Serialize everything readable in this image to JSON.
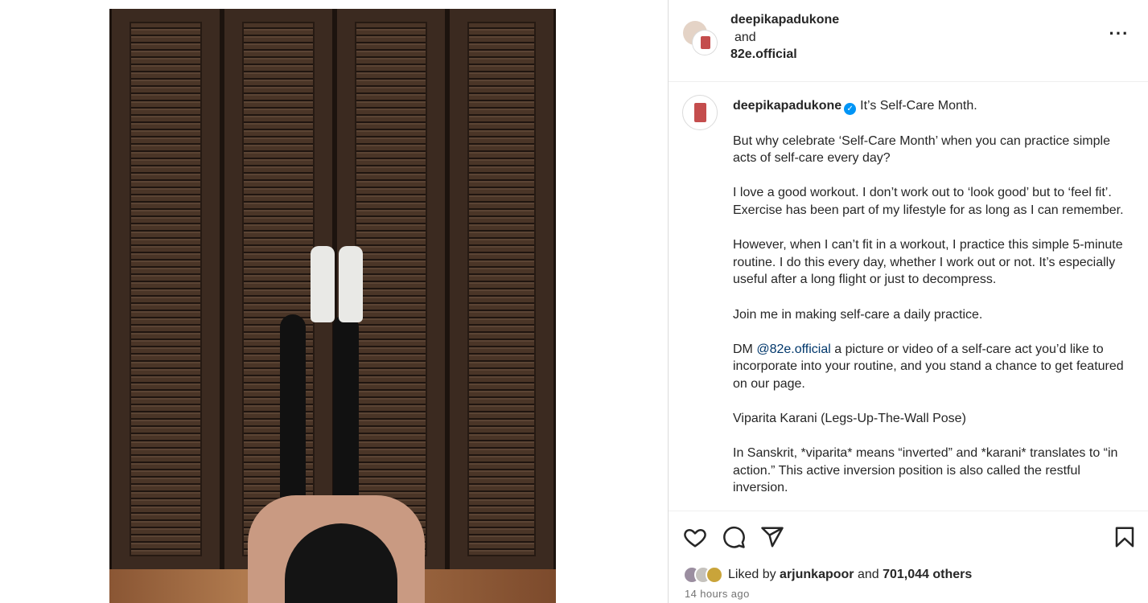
{
  "header": {
    "user1": "deepikapadukone",
    "and": "and",
    "user2": "82e.official",
    "more": "···"
  },
  "caption": {
    "username": "deepikapadukone",
    "verified_icon": "verified-badge",
    "first_line": "It’s Self-Care Month.",
    "p1": "But why celebrate ‘Self-Care Month’ when you can practice simple acts of self-care every day?",
    "p2": "I love a good workout. I don’t work out to ‘look good’ but to ‘feel fit’. Exercise has been part of my lifestyle for as long as I can remember.",
    "p3": "However, when I can’t fit in a workout, I practice this simple 5-minute routine. I do this every day, whether I work out or not. It’s especially useful after a long flight or just to decompress.",
    "p4": "Join me in making self-care a daily practice.",
    "p5_pre": "DM ",
    "p5_mention": "@82e.official",
    "p5_post": " a picture or video of a self-care act you’d like to incorporate into your routine, and you stand a chance to get featured on our page.",
    "p6": "Viparita Karani (Legs-Up-The-Wall Pose)",
    "p7": "In Sanskrit, *viparita* means “inverted” and *karani* translates to “in action.” This active inversion position is also called the restful inversion."
  },
  "actions": {
    "like_icon": "heart-icon",
    "comment_icon": "comment-icon",
    "share_icon": "share-icon",
    "save_icon": "bookmark-icon"
  },
  "likes": {
    "prefix": "Liked by ",
    "user": "arjunkapoor",
    "mid": " and ",
    "count": "701,044 others"
  },
  "timestamp": "14 hours ago",
  "colors": {
    "verified": "#0095f6",
    "mention": "#00376b",
    "muted": "#737373"
  }
}
